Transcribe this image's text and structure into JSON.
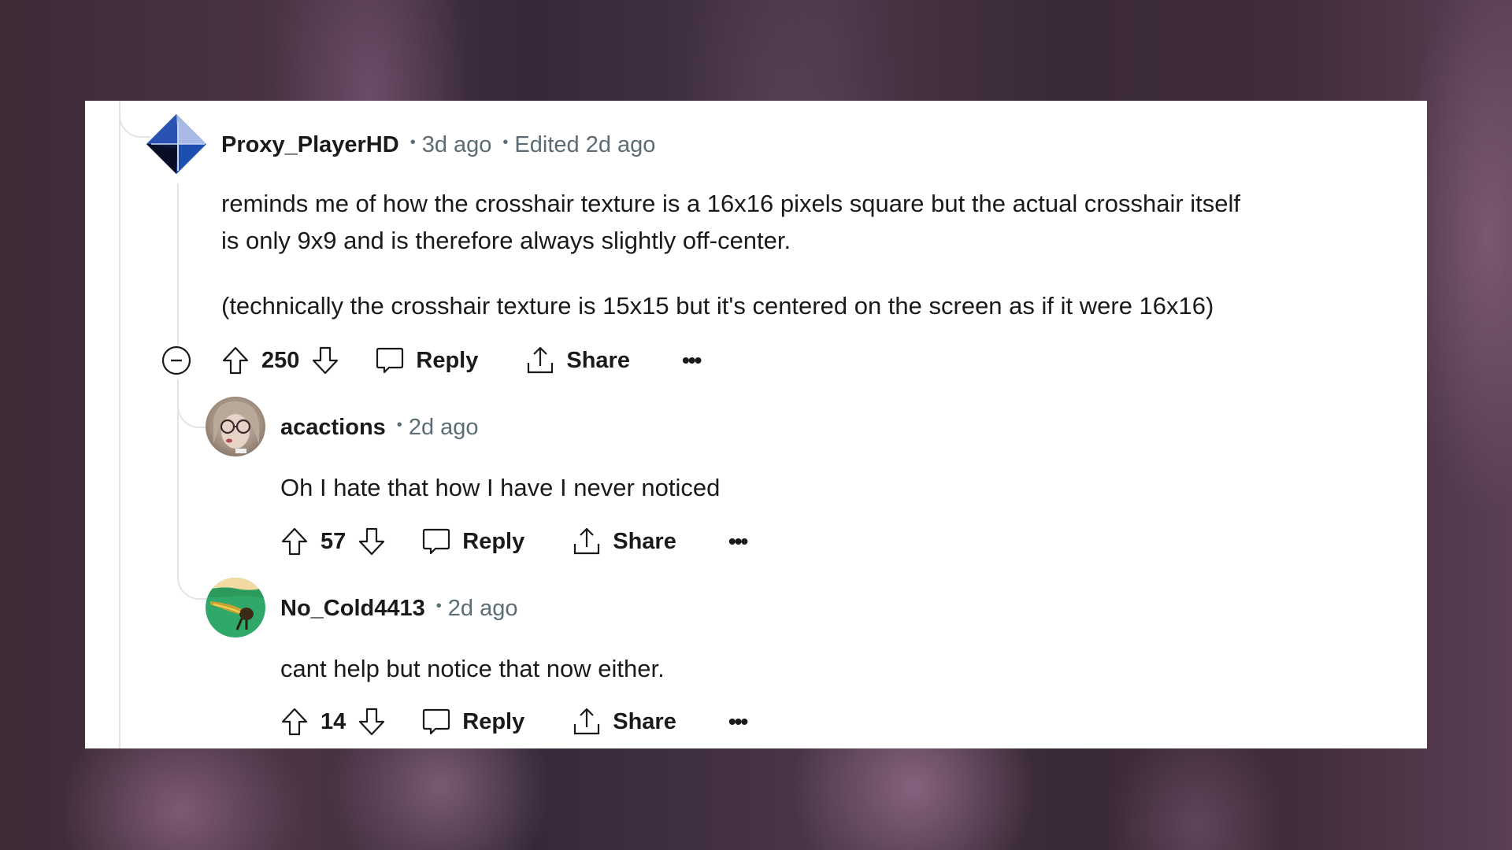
{
  "comments": [
    {
      "username": "Proxy_PlayerHD",
      "time": "3d ago",
      "edited": "Edited 2d ago",
      "avatar": "diamond-avatar",
      "body": [
        "reminds me of how the crosshair texture is a 16x16 pixels square but the actual crosshair itself",
        "is only 9x9 and is therefore always slightly off-center.",
        "(technically the crosshair texture is 15x15 but it's centered on the screen as if it were 16x16)"
      ],
      "votes": "250",
      "reply_label": "Reply",
      "share_label": "Share",
      "more_label": "•••"
    },
    {
      "username": "acactions",
      "time": "2d ago",
      "avatar": "anime-girl-glasses-avatar",
      "body": [
        "Oh I hate that how I have I never noticed"
      ],
      "votes": "57",
      "reply_label": "Reply",
      "share_label": "Share",
      "more_label": "•••"
    },
    {
      "username": "No_Cold4413",
      "time": "2d ago",
      "avatar": "dragonfly-avatar",
      "body": [
        "cant help but notice that now either."
      ],
      "votes": "14",
      "reply_label": "Reply",
      "share_label": "Share",
      "more_label": "•••"
    }
  ],
  "colors": {
    "text": "#1a1a1b",
    "meta": "#5c6c74",
    "thread_line": "#e2e5e7",
    "card": "#ffffff"
  },
  "separator": "•"
}
